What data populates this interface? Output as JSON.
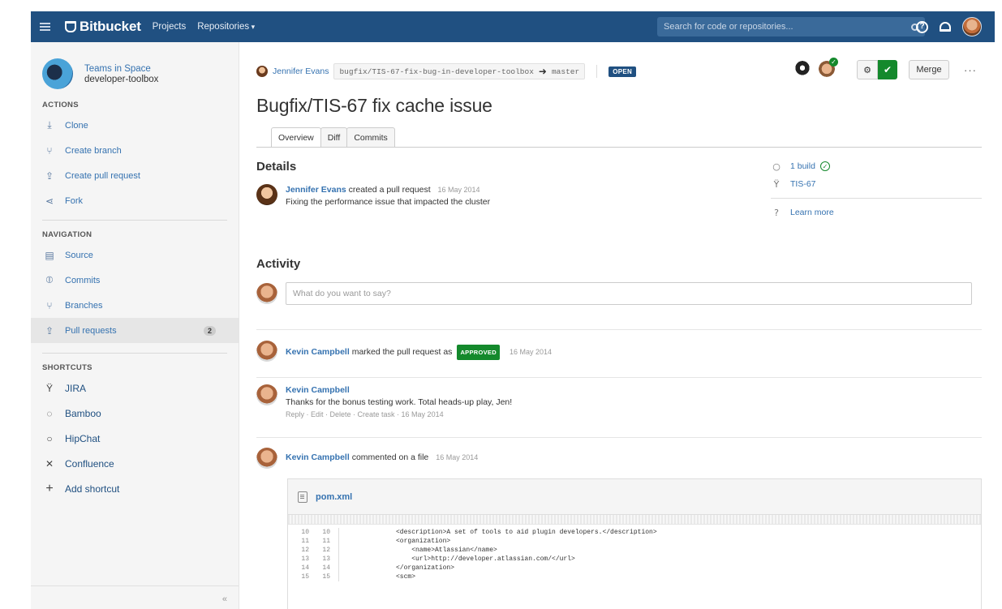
{
  "topbar": {
    "brand": "Bitbucket",
    "nav": [
      "Projects",
      "Repositories"
    ],
    "search_placeholder": "Search for code or repositories...",
    "icons": [
      "menu-icon",
      "bitbucket-logo-icon",
      "search-icon",
      "help-icon",
      "notification-bell-icon",
      "user-avatar"
    ]
  },
  "sidebar": {
    "project_name": "Teams in Space",
    "repo_name": "developer-toolbox",
    "actions_title": "ACTIONS",
    "actions": [
      {
        "label": "Clone",
        "icon": "clone-icon"
      },
      {
        "label": "Create branch",
        "icon": "create-branch-icon"
      },
      {
        "label": "Create pull request",
        "icon": "create-pull-request-icon"
      },
      {
        "label": "Fork",
        "icon": "fork-icon"
      }
    ],
    "navigation_title": "NAVIGATION",
    "navigation": [
      {
        "label": "Source",
        "icon": "source-icon"
      },
      {
        "label": "Commits",
        "icon": "commits-icon"
      },
      {
        "label": "Branches",
        "icon": "branches-icon"
      },
      {
        "label": "Pull requests",
        "icon": "pull-requests-icon",
        "count": "2"
      }
    ],
    "shortcuts_title": "SHORTCUTS",
    "shortcuts": [
      {
        "label": "JIRA",
        "icon": "jira-icon"
      },
      {
        "label": "Bamboo",
        "icon": "bamboo-icon"
      },
      {
        "label": "HipChat",
        "icon": "hipchat-icon"
      },
      {
        "label": "Confluence",
        "icon": "confluence-icon"
      },
      {
        "label": "Add shortcut",
        "icon": "plus-icon"
      }
    ],
    "collapse": "«"
  },
  "pr": {
    "author": "Jennifer Evans",
    "source_branch": "bugfix/TIS-67-fix-bug-in-developer-toolbox",
    "target_branch": "master",
    "status": "OPEN",
    "title": "Bugfix/TIS-67 fix cache issue",
    "merge_label": "Merge",
    "more_label": "···",
    "tabs": [
      "Overview",
      "Diff",
      "Commits"
    ]
  },
  "details": {
    "heading": "Details",
    "author": "Jennifer Evans",
    "action": "created a pull request",
    "date": "16 May 2014",
    "description": "Fixing the performance issue that impacted the cluster",
    "build": "1 build",
    "issue": "TIS-67",
    "learn_more": "Learn more"
  },
  "activity": {
    "heading": "Activity",
    "placeholder": "What do you want to say?",
    "items": [
      {
        "user": "Kevin Campbell",
        "text": "marked the pull request as",
        "lozenge": "APPROVED",
        "date": "16 May 2014"
      },
      {
        "user": "Kevin Campbell",
        "text": "Thanks for the bonus testing work. Total heads-up play, Jen!",
        "links": "Reply · Edit · Delete · Create task · 16 May 2014"
      },
      {
        "user": "Kevin Campbell",
        "text": "commented on a file",
        "date": "16 May 2014"
      }
    ]
  },
  "file": {
    "name": "pom.xml",
    "lines": [
      {
        "a": "10",
        "b": "10",
        "code": "<description>A set of tools to aid plugin developers.</description>"
      },
      {
        "a": "11",
        "b": "11",
        "code": "<organization>"
      },
      {
        "a": "12",
        "b": "12",
        "code": "    <name>Atlassian</name>"
      },
      {
        "a": "13",
        "b": "13",
        "code": "    <url>http://developer.atlassian.com/</url>"
      },
      {
        "a": "14",
        "b": "14",
        "code": "</organization>"
      },
      {
        "a": "15",
        "b": "15",
        "code": "<scm>"
      }
    ]
  },
  "colors": {
    "topbar": "#205081",
    "link": "#3572b0",
    "approve": "#14892c"
  }
}
